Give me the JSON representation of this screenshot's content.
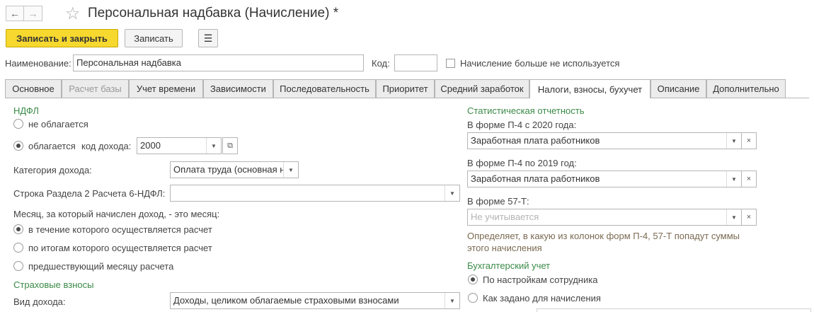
{
  "window": {
    "title": "Персональная надбавка (Начисление) *",
    "back_label": "←",
    "forward_label": "→"
  },
  "toolbar": {
    "save_close_label": "Записать и закрыть",
    "save_label": "Записать"
  },
  "header": {
    "name_label": "Наименование:",
    "name_value": "Персональная надбавка",
    "code_label": "Код:",
    "code_value": "",
    "unused_label": "Начисление больше не используется"
  },
  "tabs": [
    {
      "label": "Основное"
    },
    {
      "label": "Расчет базы"
    },
    {
      "label": "Учет времени"
    },
    {
      "label": "Зависимости"
    },
    {
      "label": "Последовательность"
    },
    {
      "label": "Приоритет"
    },
    {
      "label": "Средний заработок"
    },
    {
      "label": "Налоги, взносы, бухучет"
    },
    {
      "label": "Описание"
    },
    {
      "label": "Дополнительно"
    }
  ],
  "ndfl": {
    "section_title": "НДФЛ",
    "not_taxed_label": "не облагается",
    "taxed_label": "облагается",
    "income_code_label": "код дохода:",
    "income_code_value": "2000",
    "income_category_label": "Категория дохода:",
    "income_category_value": "Оплата труда (основная н",
    "row_6ndfl_label": "Строка Раздела 2 Расчета 6-НДФЛ:",
    "row_6ndfl_value": "",
    "month_question": "Месяц, за который начислен доход, - это месяц:",
    "month_option_1": "в течение которого осуществляется расчет",
    "month_option_2": "по итогам которого осуществляется расчет",
    "month_option_3": "предшествующий месяцу расчета"
  },
  "insurance": {
    "section_title": "Страховые взносы",
    "income_type_label": "Вид дохода:",
    "income_type_value": "Доходы, целиком облагаемые страховыми взносами"
  },
  "stats": {
    "section_title": "Статистическая отчетность",
    "p4_2020_label": "В форме П-4 с 2020 года:",
    "p4_2020_value": "Заработная плата работников",
    "p4_2019_label": "В форме П-4 по 2019 год:",
    "p4_2019_value": "Заработная плата работников",
    "f57t_label": "В форме 57-Т:",
    "f57t_placeholder": "Не учитывается",
    "hint_line1": "Определяет, в какую из колонок форм П-4, 57-Т попадут суммы",
    "hint_line2": "этого начисления"
  },
  "accounting": {
    "section_title": "Бухгалтерский учет",
    "option_1": "По настройкам сотрудника",
    "option_2": "Как задано для начисления"
  },
  "icons": {
    "star": "☆",
    "list": "☰",
    "dropdown": "▼",
    "open": "⧉",
    "clear": "×"
  },
  "colors": {
    "primary_button": "#f6d82f",
    "section_title": "#3a8a47",
    "hint_text": "#7a6a52"
  }
}
